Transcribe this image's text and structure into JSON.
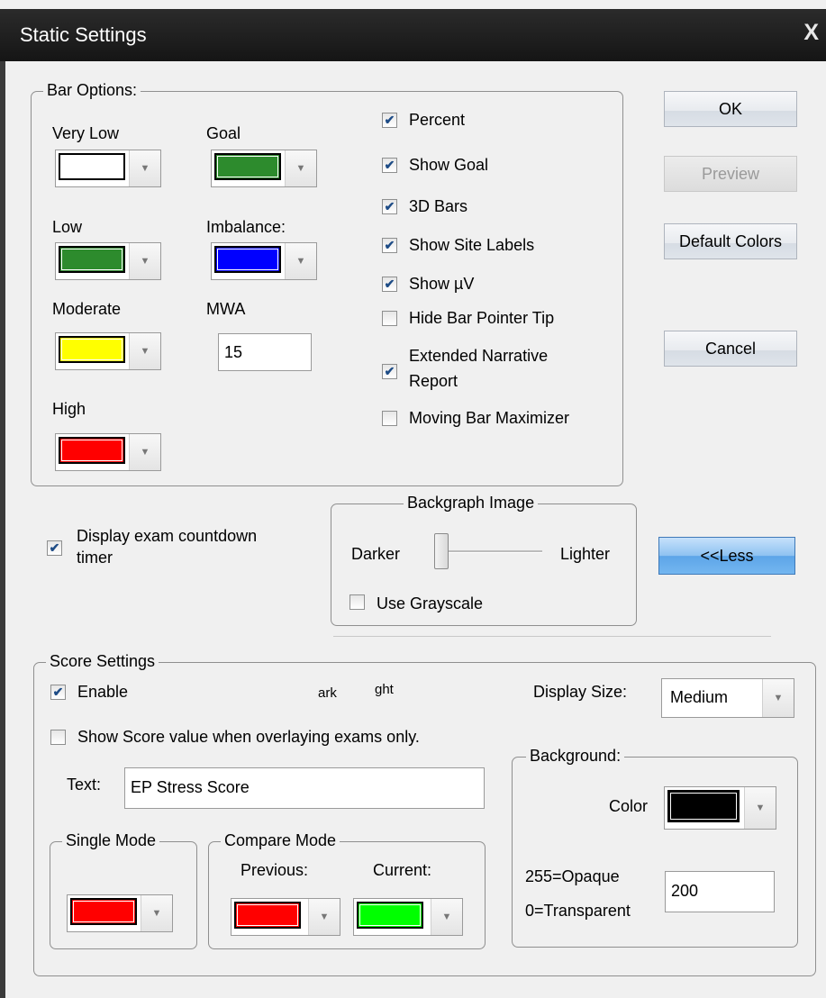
{
  "window": {
    "title": "Static Settings",
    "close_glyph": "X"
  },
  "bar_options": {
    "legend": "Bar Options:",
    "very_low": {
      "label": "Very Low",
      "color": "#ffffff"
    },
    "goal": {
      "label": "Goal",
      "color": "#2d8b2d"
    },
    "low": {
      "label": "Low",
      "color": "#2d8b2d"
    },
    "imbalance": {
      "label": "Imbalance:",
      "color": "#0000ff"
    },
    "moderate": {
      "label": "Moderate",
      "color": "#ffff00"
    },
    "mwa": {
      "label": "MWA",
      "value": "15"
    },
    "high": {
      "label": "High",
      "color": "#ff0000"
    },
    "checkboxes": [
      {
        "label": "Percent",
        "checked": true
      },
      {
        "label": "Show Goal",
        "checked": true
      },
      {
        "label": "3D Bars",
        "checked": true
      },
      {
        "label": "Show Site Labels",
        "checked": true
      },
      {
        "label": "Show µV",
        "checked": true
      },
      {
        "label": "Hide Bar Pointer Tip",
        "checked": false
      },
      {
        "label": "Extended Narrative Report",
        "checked": true
      },
      {
        "label": "Moving Bar Maximizer",
        "checked": false
      }
    ],
    "extended_line1": "Extended Narrative",
    "extended_line2": "Report"
  },
  "buttons": {
    "ok": "OK",
    "preview": "Preview",
    "default_colors": "Default Colors",
    "cancel": "Cancel",
    "less": "<<Less"
  },
  "countdown": {
    "line1": "Display exam countdown",
    "line2": "timer",
    "checked": true
  },
  "backgraph": {
    "legend": "Backgraph Image",
    "darker": "Darker",
    "lighter": "Lighter",
    "level": 0,
    "grayscale_label": "Use Grayscale",
    "grayscale_checked": false
  },
  "score": {
    "legend": "Score Settings",
    "enable_label": "Enable",
    "enable_checked": true,
    "frag_dark": "ark",
    "frag_light": "ght",
    "display_size_label": "Display Size:",
    "display_size_value": "Medium",
    "show_overlay_label": "Show Score value when overlaying exams only.",
    "show_overlay_checked": false,
    "text_label": "Text:",
    "text_value": "EP Stress Score",
    "single_mode": {
      "legend": "Single Mode",
      "color": "#ff0000"
    },
    "compare_mode": {
      "legend": "Compare Mode",
      "previous_label": "Previous:",
      "current_label": "Current:",
      "previous_color": "#ff0000",
      "current_color": "#00ff00"
    },
    "background": {
      "legend": "Background:",
      "color_label": "Color",
      "color": "#000000",
      "opaque_label": "255=Opaque",
      "transparent_label": "0=Transparent",
      "opacity_value": "200"
    }
  },
  "icons": {
    "check": "✔",
    "dropdown": "chevron-down-icon",
    "close": "close-icon"
  }
}
